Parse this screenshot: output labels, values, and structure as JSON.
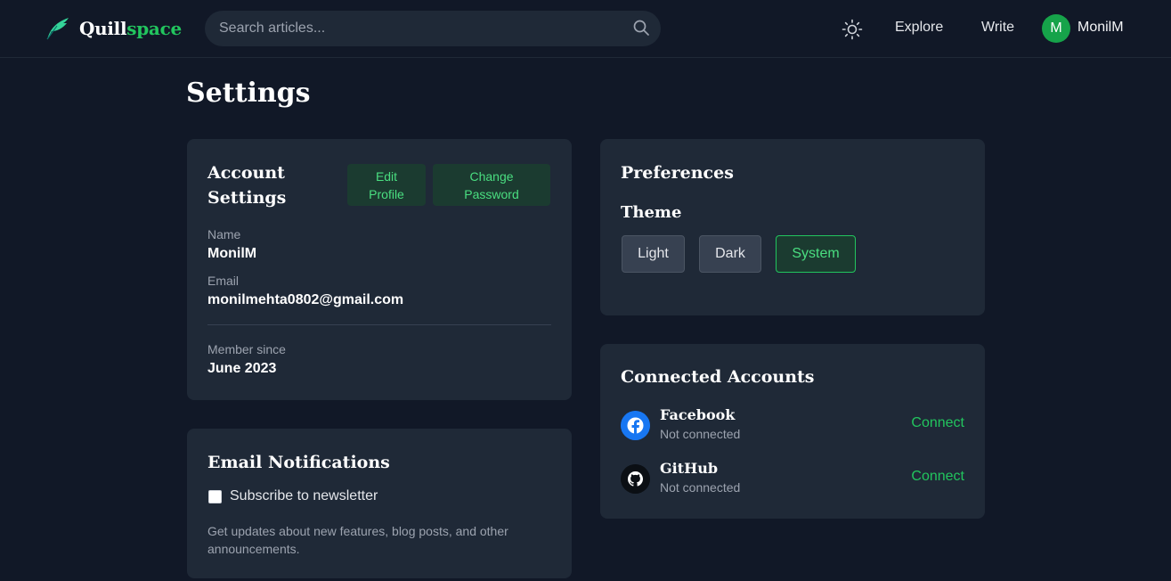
{
  "header": {
    "logo": {
      "part1": "Quill",
      "part2": "space"
    },
    "search": {
      "placeholder": "Search articles..."
    },
    "nav": {
      "explore": "Explore",
      "write": "Write"
    },
    "user": {
      "initial": "M",
      "name": "MonilM"
    }
  },
  "page": {
    "title": "Settings"
  },
  "account": {
    "title_line1": "Account",
    "title_line2": "Settings",
    "edit_profile_line1": "Edit",
    "edit_profile_line2": "Profile",
    "change_password_line1": "Change",
    "change_password_line2": "Password",
    "name_label": "Name",
    "name_value": "MonilM",
    "email_label": "Email",
    "email_value": "monilmehta0802@gmail.com",
    "member_label": "Member since",
    "member_value": "June 2023"
  },
  "email_notifications": {
    "title": "Email Notifications",
    "checkbox_label": "Subscribe to newsletter",
    "checked": false,
    "help_text": "Get updates about new features, blog posts, and other announcements."
  },
  "preferences": {
    "title": "Preferences",
    "theme_label": "Theme",
    "themes": [
      "Light",
      "Dark",
      "System"
    ],
    "selected_theme": "System"
  },
  "connected": {
    "title": "Connected Accounts",
    "providers": [
      {
        "name": "Facebook",
        "status": "Not connected",
        "action": "Connect",
        "icon": "facebook-icon"
      },
      {
        "name": "GitHub",
        "status": "Not connected",
        "action": "Connect",
        "icon": "github-icon"
      }
    ]
  },
  "colors": {
    "background": "#111827",
    "card": "#1f2937",
    "accent": "#22c55e"
  }
}
